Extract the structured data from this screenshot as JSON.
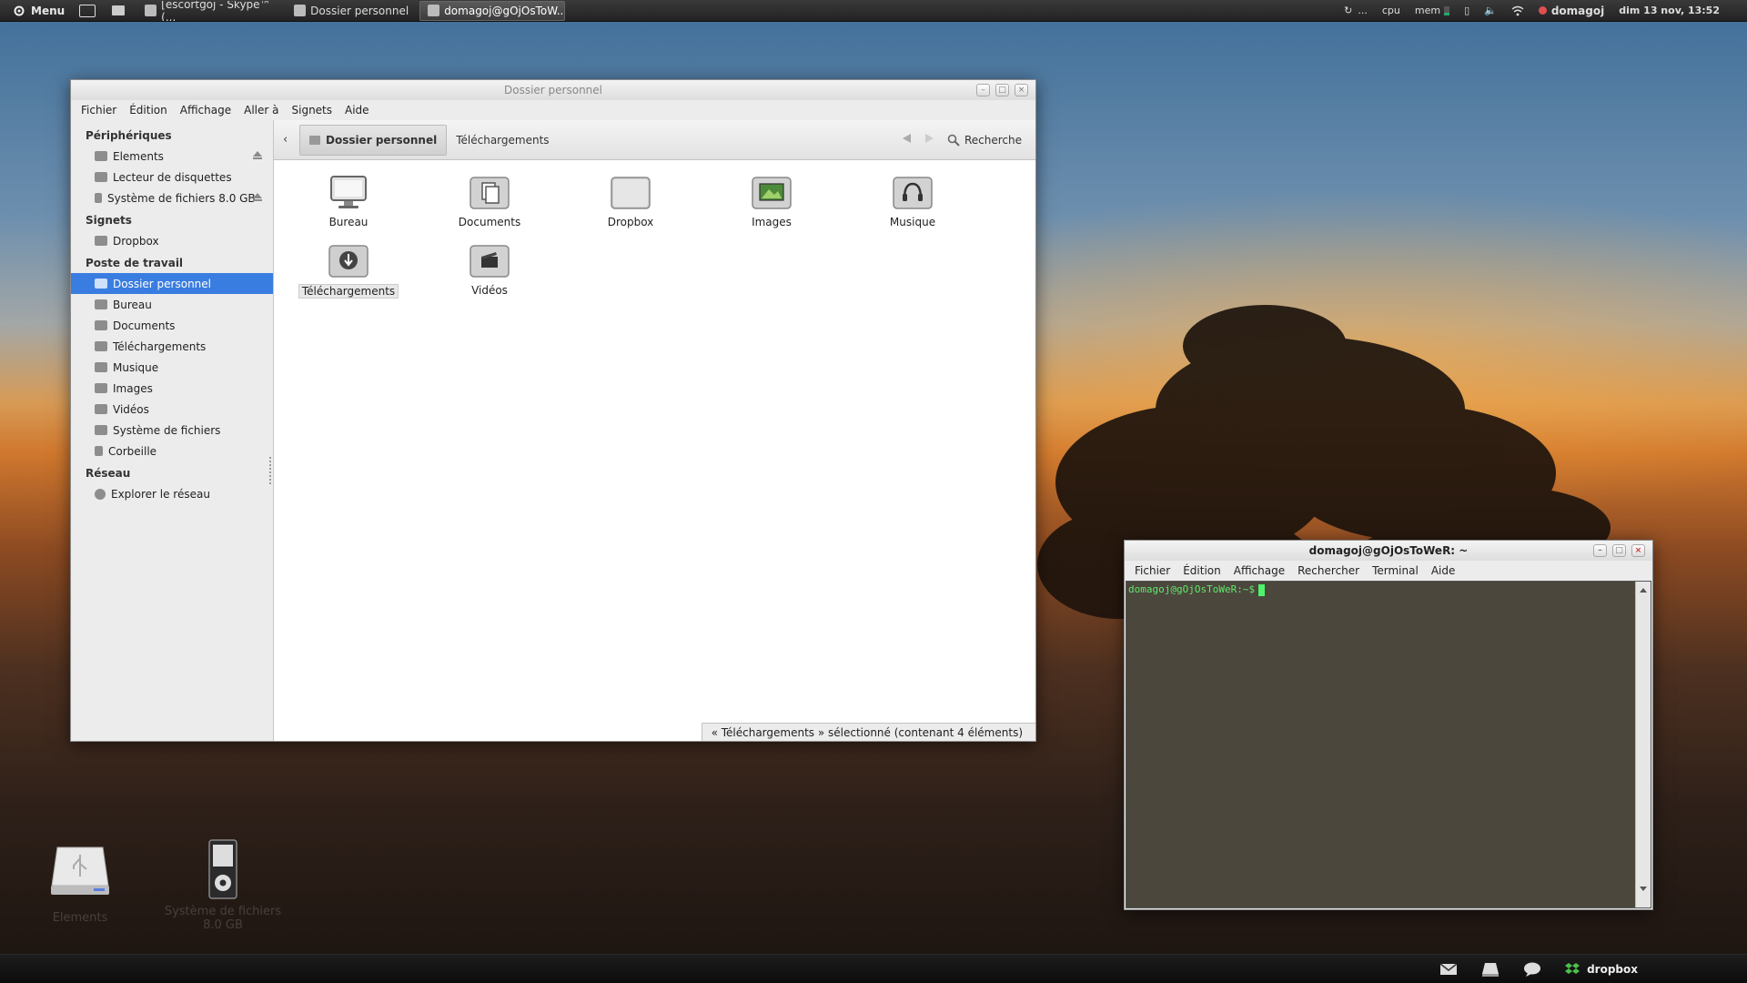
{
  "top_panel": {
    "menu_label": "Menu",
    "tasks": [
      {
        "label": "[escortgoj - Skype™ (..."
      },
      {
        "label": "Dossier personnel"
      },
      {
        "label": "domagoj@gOjOsToW..."
      }
    ],
    "sync_label": "...",
    "cpu_label": "cpu",
    "mem_label": "mem",
    "user_label": "domagoj",
    "clock": "dim 13 nov, 13:52"
  },
  "file_manager": {
    "title": "Dossier personnel",
    "menu": [
      "Fichier",
      "Édition",
      "Affichage",
      "Aller à",
      "Signets",
      "Aide"
    ],
    "sidebar": {
      "sections": [
        {
          "title": "Périphériques",
          "items": [
            "Elements",
            "Lecteur de disquettes",
            "Système de fichiers 8.0 GB"
          ]
        },
        {
          "title": "Signets",
          "items": [
            "Dropbox"
          ]
        },
        {
          "title": "Poste de travail",
          "items": [
            "Dossier personnel",
            "Bureau",
            "Documents",
            "Téléchargements",
            "Musique",
            "Images",
            "Vidéos",
            "Système de fichiers",
            "Corbeille"
          ]
        },
        {
          "title": "Réseau",
          "items": [
            "Explorer le réseau"
          ]
        }
      ],
      "selected": "Dossier personnel"
    },
    "breadcrumbs": [
      "Dossier personnel",
      "Téléchargements"
    ],
    "search_label": "Recherche",
    "icons": [
      "Bureau",
      "Documents",
      "Dropbox",
      "Images",
      "Musique",
      "Téléchargements",
      "Vidéos"
    ],
    "selected_icon": "Téléchargements",
    "status": "« Téléchargements » sélectionné (contenant 4 éléments)"
  },
  "terminal": {
    "title": "domagoj@gOjOsToWeR: ~",
    "menu": [
      "Fichier",
      "Édition",
      "Affichage",
      "Rechercher",
      "Terminal",
      "Aide"
    ],
    "prompt": "domagoj@gOjOsToWeR:~$"
  },
  "desktop_icons": [
    {
      "label": "Elements"
    },
    {
      "label": "Système de fichiers 8.0 GB"
    }
  ],
  "bottom_panel": {
    "dropbox_label": "dropbox"
  },
  "colors": {
    "selection": "#3a7de0",
    "terminal_text": "#5ee86b"
  }
}
